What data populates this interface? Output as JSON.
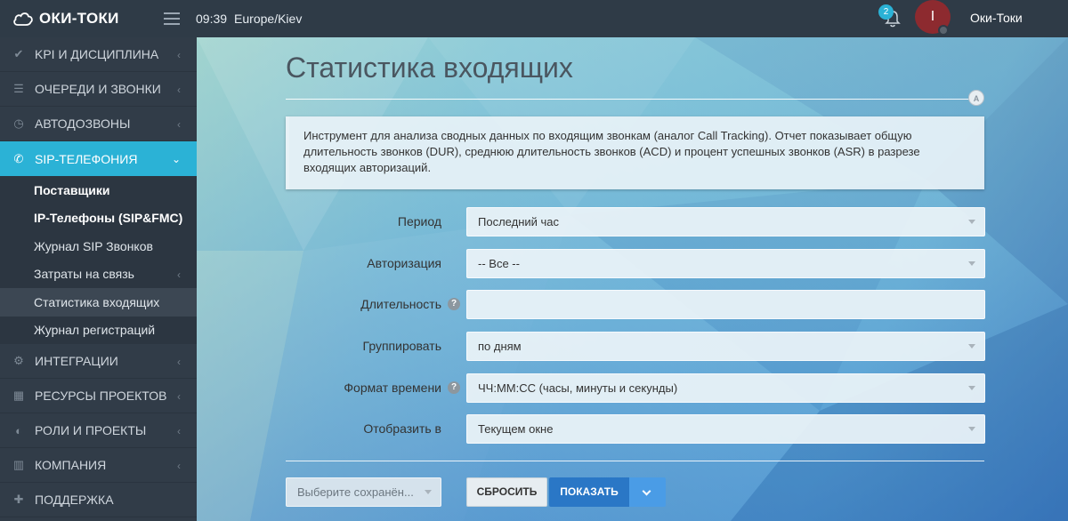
{
  "brand": {
    "name": "ОКИ-ТОКИ"
  },
  "topbar": {
    "time": "09:39",
    "timezone": "Europe/Kiev",
    "notifications_count": "2",
    "avatar_letter": "I",
    "username": "Оки-Токи"
  },
  "sidebar": {
    "items": [
      {
        "label": "KPI И ДИСЦИПЛИНА",
        "icon": "check-icon"
      },
      {
        "label": "ОЧЕРЕДИ И ЗВОНКИ",
        "icon": "list-icon"
      },
      {
        "label": "АВТОДОЗВОНЫ",
        "icon": "clock-icon"
      },
      {
        "label": "SIP-ТЕЛЕФОНИЯ",
        "icon": "phone-icon"
      },
      {
        "label": "ИНТЕГРАЦИИ",
        "icon": "gears-icon"
      },
      {
        "label": "РЕСУРСЫ ПРОЕКТОВ",
        "icon": "grid-icon"
      },
      {
        "label": "РОЛИ И ПРОЕКТЫ",
        "icon": "toggle-icon"
      },
      {
        "label": "КОМПАНИЯ",
        "icon": "bar-chart-icon"
      },
      {
        "label": "ПОДДЕРЖКА",
        "icon": "support-icon"
      }
    ],
    "sub_items": [
      {
        "label": "Поставщики"
      },
      {
        "label": "IP-Телефоны (SIP&FMC)"
      },
      {
        "label": "Журнал SIP Звонков"
      },
      {
        "label": "Затраты на связь"
      },
      {
        "label": "Статистика входящих"
      },
      {
        "label": "Журнал регистраций"
      }
    ]
  },
  "main": {
    "title": "Статистика входящих",
    "title_marker": "A",
    "info": "Инструмент для анализа сводных данных по входящим звонкам (аналог Call Tracking). Отчет показывает общую длительность звонков (DUR), среднюю длительность звонков (ACD) и процент успешных звонков (ASR) в разрезе входящих авторизаций.",
    "form": {
      "period": {
        "label": "Период",
        "value": "Последний час"
      },
      "auth": {
        "label": "Авторизация",
        "value": "-- Все --"
      },
      "duration": {
        "label": "Длительность",
        "value": ""
      },
      "group": {
        "label": "Группировать",
        "value": "по дням"
      },
      "time_format": {
        "label": "Формат времени",
        "value": "ЧЧ:ММ:СС (часы, минуты и секунды)"
      },
      "show_in": {
        "label": "Отобразить в",
        "value": "Текущем окне"
      }
    },
    "saved": {
      "placeholder": "Выберите сохранён..."
    },
    "buttons": {
      "reset": "СБРОСИТЬ",
      "show": "ПОКАЗАТЬ"
    }
  }
}
